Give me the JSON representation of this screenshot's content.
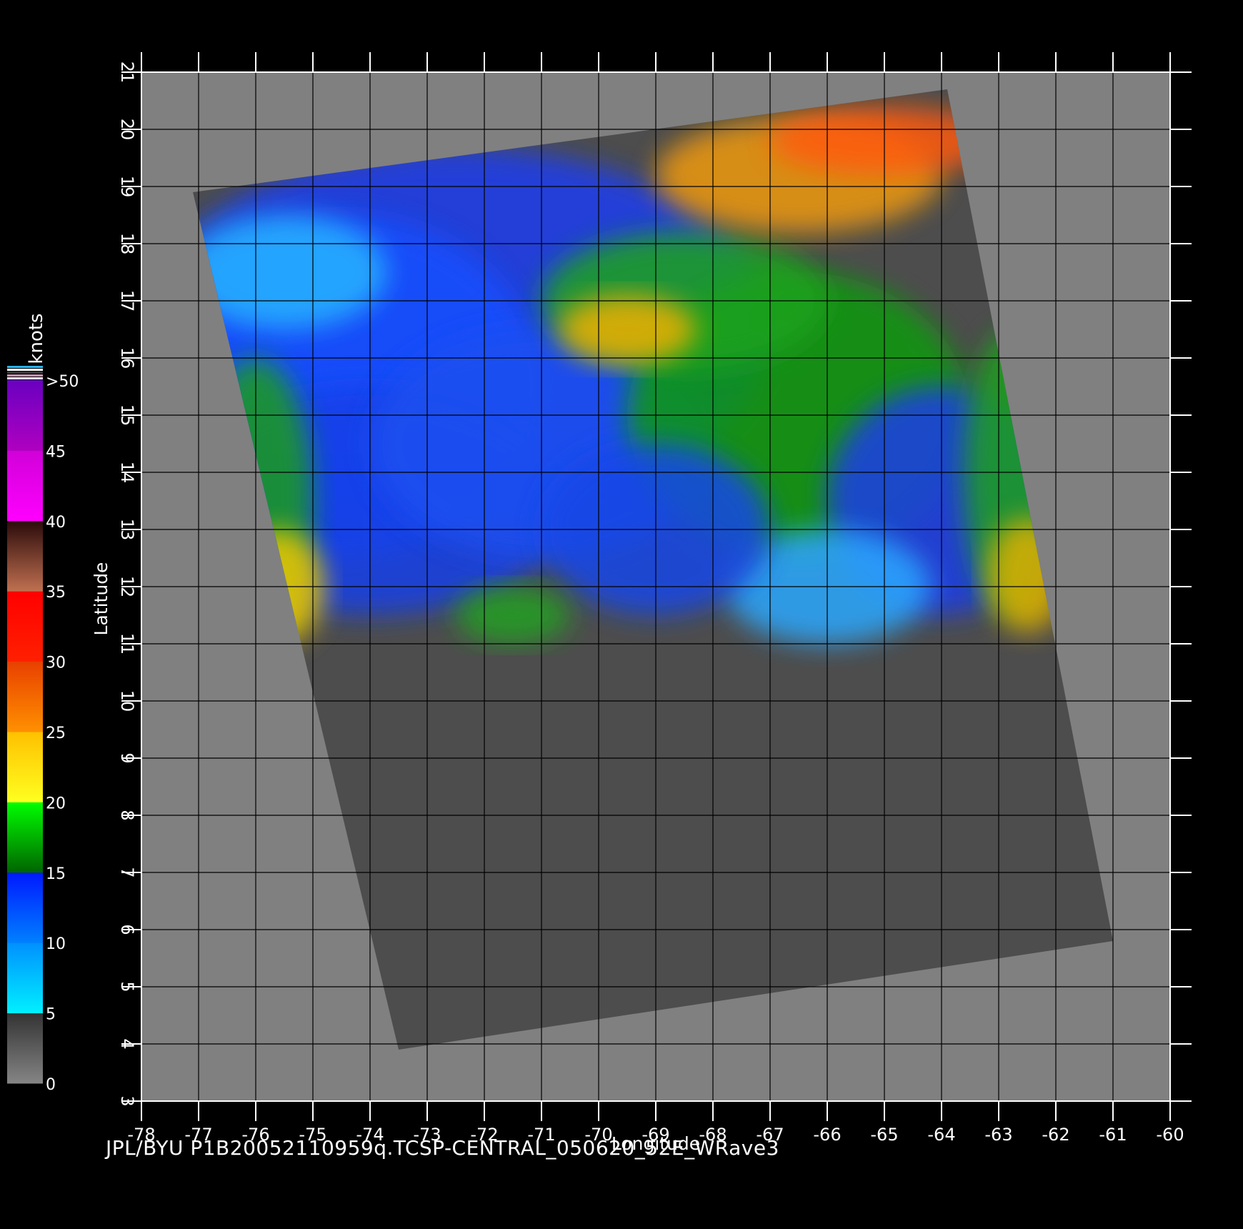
{
  "map": {
    "title": "",
    "xlabel": "Longitude",
    "ylabel": "Latitude",
    "lon_range": [
      -78,
      -60
    ],
    "lat_range": [
      3,
      21
    ],
    "lon_ticks": [
      "-78",
      "-77",
      "-76",
      "-75",
      "-74",
      "-73",
      "-72",
      "-71",
      "-70",
      "-69",
      "-68",
      "-67",
      "-66",
      "-65",
      "-64",
      "-63",
      "-62",
      "-61",
      "-60"
    ],
    "lat_ticks": [
      "3",
      "4",
      "5",
      "6",
      "7",
      "8",
      "9",
      "10",
      "11",
      "12",
      "13",
      "14",
      "15",
      "16",
      "17",
      "18",
      "19",
      "20",
      "21"
    ],
    "grid": true,
    "background_color": "#808080",
    "swath_color": "#4d4d4d",
    "swath_corners_lonlat": [
      [
        -77.1,
        18.9
      ],
      [
        -63.9,
        20.7
      ],
      [
        -61.0,
        5.8
      ],
      [
        -73.5,
        3.9
      ]
    ]
  },
  "legend": {
    "unit": "knots",
    "labels": [
      "0",
      "5",
      "10",
      "15",
      "20",
      "25",
      "30",
      "35",
      "40",
      "45",
      ">50"
    ],
    "bands": [
      {
        "from": 0,
        "to": 5,
        "colors": [
          "#858585",
          "#333333"
        ]
      },
      {
        "from": 5,
        "to": 10,
        "colors": [
          "#00f0ff",
          "#0090ff"
        ]
      },
      {
        "from": 10,
        "to": 15,
        "colors": [
          "#0080ff",
          "#0018ff"
        ]
      },
      {
        "from": 15,
        "to": 20,
        "colors": [
          "#006400",
          "#00ff00"
        ]
      },
      {
        "from": 20,
        "to": 25,
        "colors": [
          "#ffff20",
          "#ffc000"
        ]
      },
      {
        "from": 25,
        "to": 30,
        "colors": [
          "#ff9000",
          "#e84000"
        ]
      },
      {
        "from": 30,
        "to": 35,
        "colors": [
          "#ff2000",
          "#ff0000"
        ]
      },
      {
        "from": 35,
        "to": 40,
        "colors": [
          "#c07050",
          "#2a0a0a"
        ]
      },
      {
        "from": 40,
        "to": 45,
        "colors": [
          "#ff00ff",
          "#d000d8"
        ]
      },
      {
        "from": 45,
        "to": 50,
        "colors": [
          "#b000c0",
          "#6a00c0"
        ]
      }
    ]
  },
  "footer": {
    "text": "JPL/BYU  P1B20052110959q.TCSP-CENTRAL_050620_52E_WRave3"
  }
}
